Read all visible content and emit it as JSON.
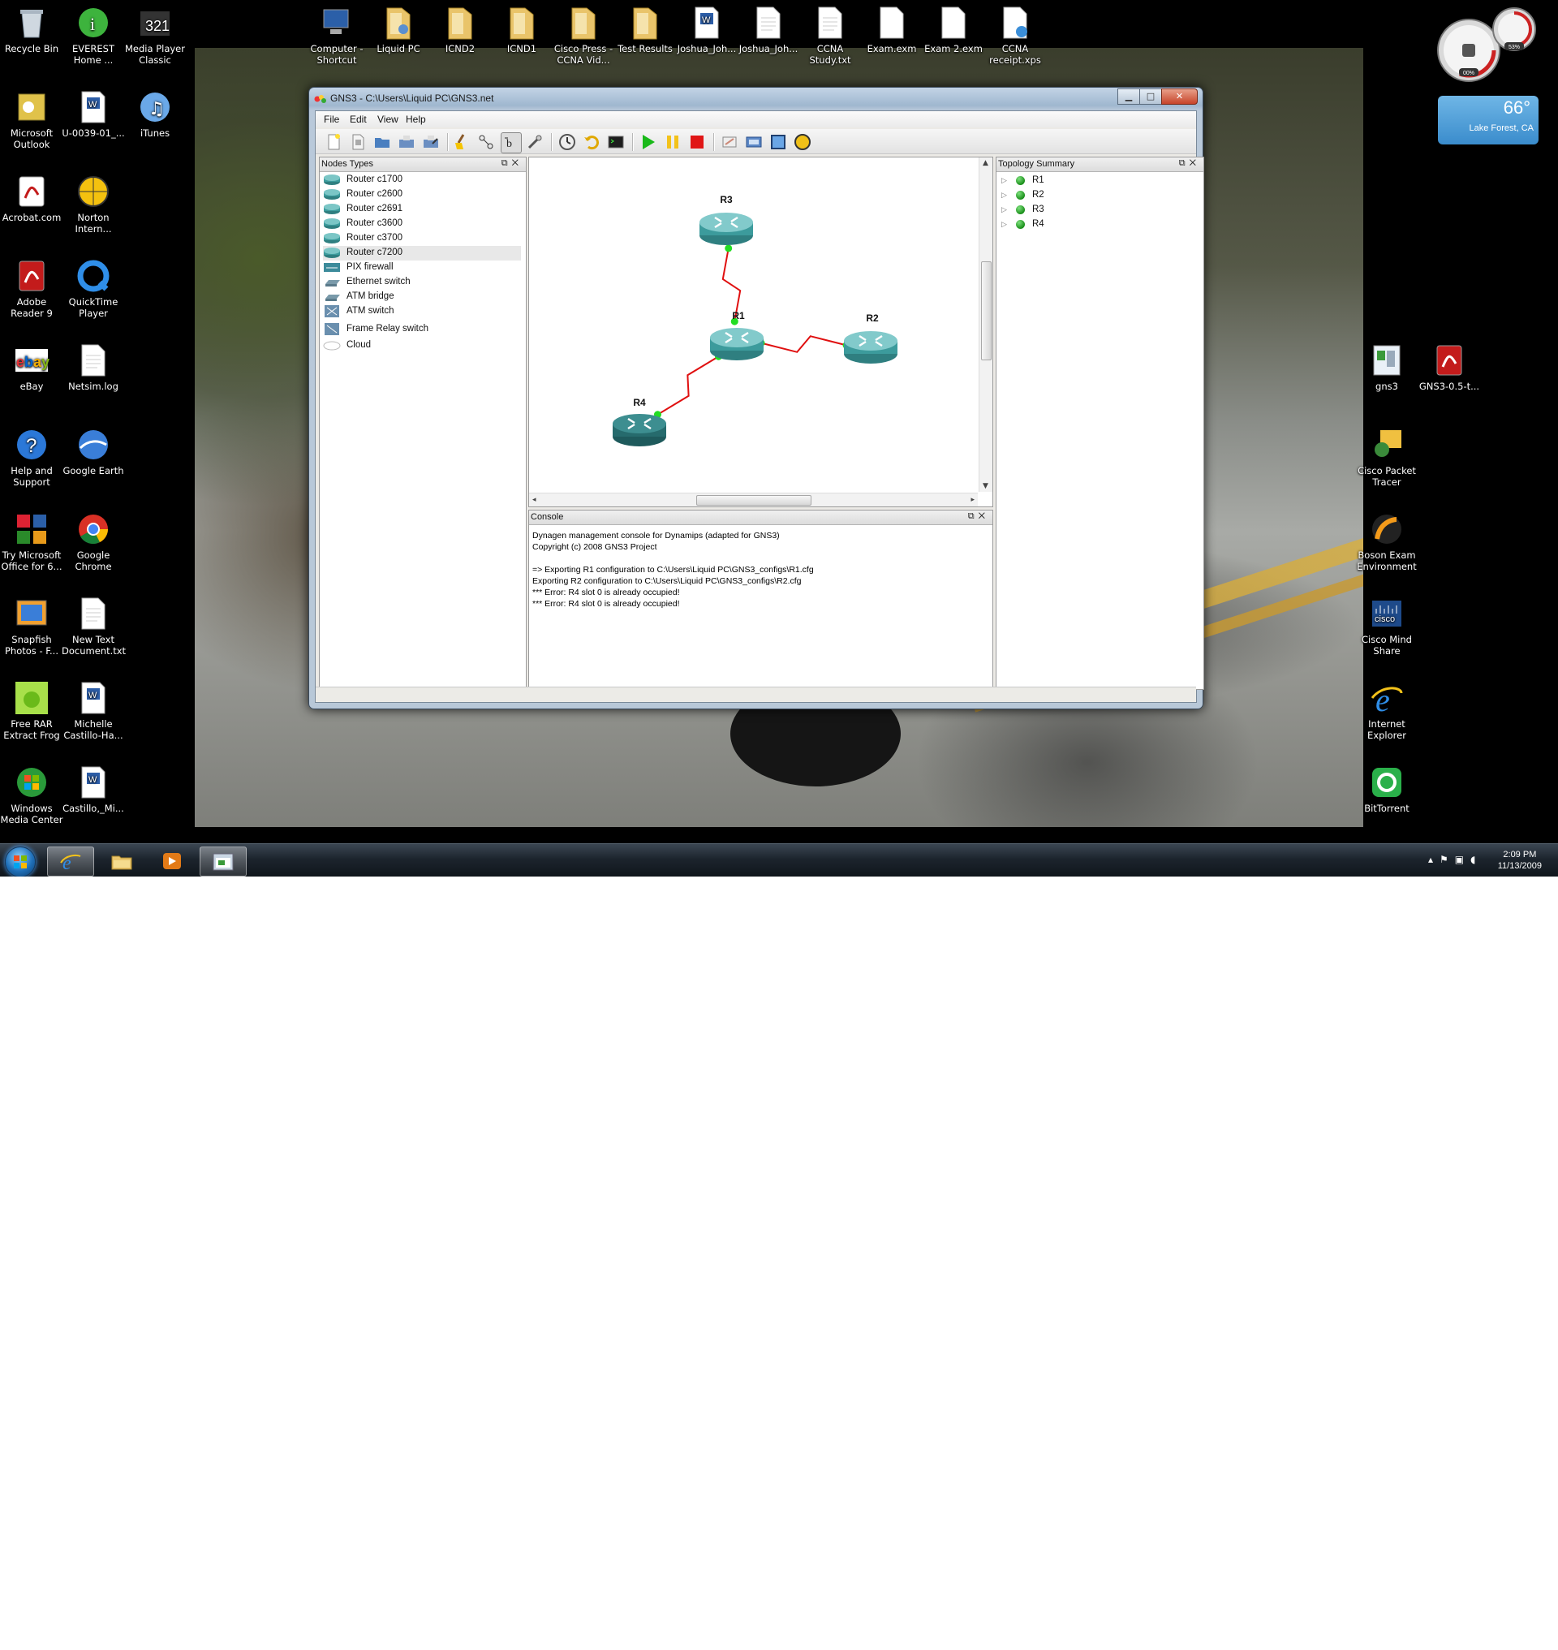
{
  "desktop": {
    "left_icons": [
      {
        "label": "Recycle Bin",
        "icon": "recycle-bin-icon"
      },
      {
        "label": "EVEREST\nHome ...",
        "icon": "everest-icon"
      },
      {
        "label": "Media Player\nClassic",
        "icon": "media-player-classic-icon"
      },
      {
        "label": "Microsoft\nOutlook",
        "icon": "outlook-icon"
      },
      {
        "label": "U-0039-01_...",
        "icon": "word-document-icon"
      },
      {
        "label": "iTunes",
        "icon": "itunes-icon"
      },
      {
        "label": "Acrobat.com",
        "icon": "acrobat-icon"
      },
      {
        "label": "Norton\nIntern...",
        "icon": "norton-icon"
      },
      {
        "label": "Adobe\nReader 9",
        "icon": "adobe-reader-icon"
      },
      {
        "label": "QuickTime\nPlayer",
        "icon": "quicktime-icon"
      },
      {
        "label": "eBay",
        "icon": "ebay-icon"
      },
      {
        "label": "Netsim.log",
        "icon": "text-file-icon"
      },
      {
        "label": "Help and\nSupport",
        "icon": "help-icon"
      },
      {
        "label": "Google Earth",
        "icon": "google-earth-icon"
      },
      {
        "label": "Try Microsoft\nOffice for 6...",
        "icon": "office-icon"
      },
      {
        "label": "Google\nChrome",
        "icon": "chrome-icon"
      },
      {
        "label": "Snapfish\nPhotos - F...",
        "icon": "snapfish-icon"
      },
      {
        "label": "New Text\nDocument.txt",
        "icon": "text-file-icon"
      },
      {
        "label": "Free RAR\nExtract Frog",
        "icon": "rar-frog-icon"
      },
      {
        "label": "Michelle\nCastillo-Ha...",
        "icon": "word-document-icon"
      },
      {
        "label": "Windows\nMedia Center",
        "icon": "media-center-icon"
      },
      {
        "label": "Castillo,_Mi...",
        "icon": "word-document-icon"
      }
    ],
    "top_icons": [
      {
        "label": "Computer -\nShortcut",
        "icon": "computer-icon"
      },
      {
        "label": "Liquid PC",
        "icon": "user-folder-icon"
      },
      {
        "label": "ICND2",
        "icon": "folder-icon"
      },
      {
        "label": "ICND1",
        "icon": "folder-icon"
      },
      {
        "label": "Cisco Press -\nCCNA Vid...",
        "icon": "folder-icon"
      },
      {
        "label": "Test Results",
        "icon": "folder-icon"
      },
      {
        "label": "Joshua_Joh...",
        "icon": "word-document-icon"
      },
      {
        "label": "Joshua_Joh...",
        "icon": "text-file-icon"
      },
      {
        "label": "CCNA\nStudy.txt",
        "icon": "text-file-icon"
      },
      {
        "label": "Exam.exm",
        "icon": "blank-file-icon"
      },
      {
        "label": "Exam 2.exm",
        "icon": "blank-file-icon"
      },
      {
        "label": "CCNA\nreceipt.xps",
        "icon": "xps-file-icon"
      }
    ],
    "right_icons": [
      {
        "label": "gns3",
        "icon": "gns3-shortcut-icon"
      },
      {
        "label": "GNS3-0.5-t...",
        "icon": "pdf-icon"
      },
      {
        "label": "Cisco Packet\nTracer",
        "icon": "packet-tracer-icon"
      },
      {
        "label": "Boson Exam\nEnvironment",
        "icon": "boson-icon"
      },
      {
        "label": "Cisco Mind\nShare",
        "icon": "cisco-icon"
      },
      {
        "label": "Internet\nExplorer",
        "icon": "internet-explorer-icon"
      },
      {
        "label": "BitTorrent",
        "icon": "bittorrent-icon"
      }
    ]
  },
  "gadgets": {
    "meter": {
      "cpu": "00%",
      "memory": "53%"
    },
    "weather": {
      "temp": "66°",
      "location": "Lake Forest, CA"
    }
  },
  "window": {
    "title": "GNS3 - C:\\Users\\Liquid PC\\GNS3.net",
    "menu": [
      "File",
      "Edit",
      "View",
      "Help"
    ],
    "toolbar": [
      "new-icon",
      "open-icon",
      "folder-open-icon",
      "save-icon",
      "save-as-icon",
      "clear-icon",
      "select-icon",
      "add-link-icon",
      "capture-icon",
      "clock-icon",
      "undo-icon",
      "console-icon",
      "start-icon",
      "pause-icon",
      "stop-icon",
      "note-icon",
      "screenshot-icon",
      "rectangle-icon",
      "ellipse-icon"
    ],
    "nodes_panel": {
      "title": "Nodes Types",
      "items": [
        {
          "label": "Router c1700",
          "icon": "router-icon"
        },
        {
          "label": "Router c2600",
          "icon": "router-icon"
        },
        {
          "label": "Router c2691",
          "icon": "router-icon"
        },
        {
          "label": "Router c3600",
          "icon": "router-icon"
        },
        {
          "label": "Router c3700",
          "icon": "router-icon"
        },
        {
          "label": "Router c7200",
          "icon": "router-icon"
        },
        {
          "label": "PIX firewall",
          "icon": "firewall-icon"
        },
        {
          "label": "Ethernet switch",
          "icon": "ethernet-switch-icon"
        },
        {
          "label": "ATM bridge",
          "icon": "atm-bridge-icon"
        },
        {
          "label": "ATM switch",
          "icon": "atm-switch-icon"
        },
        {
          "label": "Frame Relay switch",
          "icon": "frame-relay-switch-icon"
        },
        {
          "label": "Cloud",
          "icon": "cloud-icon"
        }
      ],
      "selected": "Router c7200"
    },
    "topology": {
      "routers": [
        {
          "name": "R3"
        },
        {
          "name": "R1"
        },
        {
          "name": "R2"
        },
        {
          "name": "R4"
        }
      ],
      "links": [
        {
          "from": "R3",
          "to": "R1",
          "type": "serial"
        },
        {
          "from": "R1",
          "to": "R2",
          "type": "serial"
        },
        {
          "from": "R1",
          "to": "R4",
          "type": "serial"
        }
      ],
      "link_color": "#e01010",
      "endpoint_color": "#22dd22"
    },
    "console_panel": {
      "title": "Console",
      "lines": [
        "Dynagen management console for Dynamips (adapted for GNS3)",
        "Copyright (c) 2008 GNS3 Project",
        "",
        "=> Exporting R1 configuration to C:\\Users\\Liquid PC\\GNS3_configs\\R1.cfg",
        "Exporting R2 configuration to C:\\Users\\Liquid PC\\GNS3_configs\\R2.cfg",
        "*** Error: R4 slot 0 is already occupied!",
        "*** Error: R4 slot 0 is already occupied!"
      ]
    },
    "topology_panel": {
      "title": "Topology Summary",
      "items": [
        "R1",
        "R2",
        "R3",
        "R4"
      ]
    }
  },
  "taskbar": {
    "buttons": [
      "internet-explorer-icon",
      "explorer-folder-icon",
      "media-player-icon",
      "gns3-taskbar-icon"
    ],
    "time": "2:09 PM",
    "date": "11/13/2009"
  }
}
